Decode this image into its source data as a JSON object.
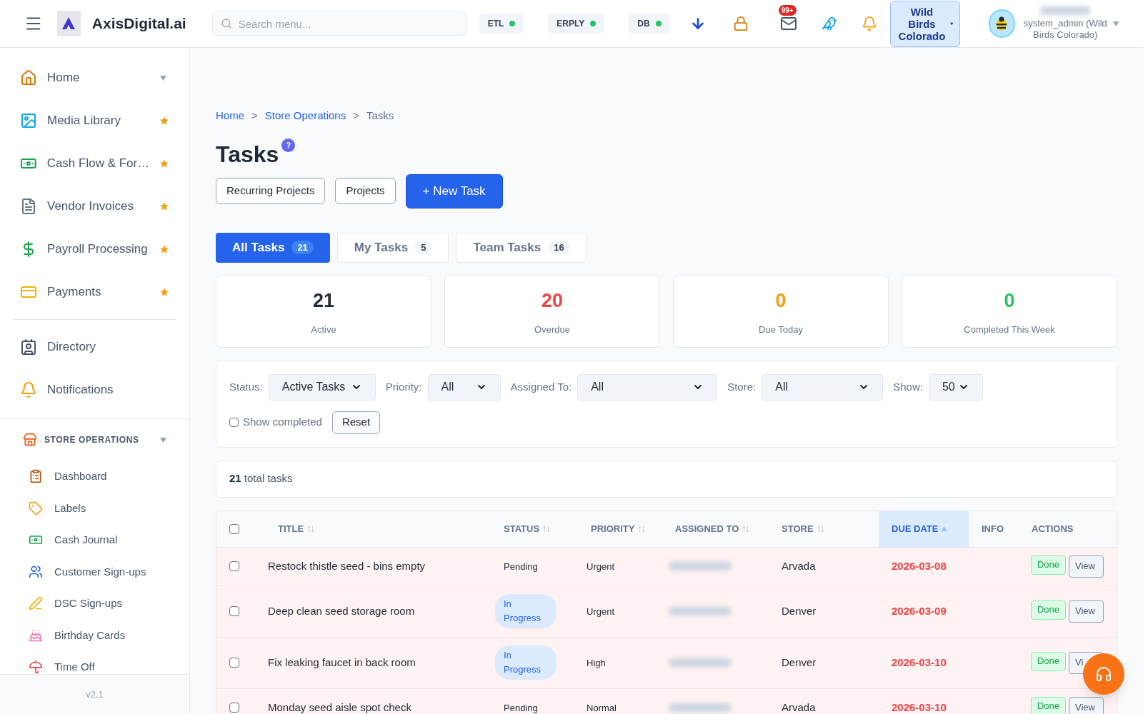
{
  "header": {
    "brand": "AxisDigital.ai",
    "search": {
      "placeholder": "Search menu..."
    },
    "services": [
      {
        "label": "ETL",
        "color": "#22c55e"
      },
      {
        "label": "ERPLY",
        "color": "#22c55e"
      },
      {
        "label": "DB",
        "color": "#22c55e"
      }
    ],
    "mail_badge": "99+",
    "store_button": "Wild Birds Colorado",
    "user_role": "system_admin (Wild Birds Colorado)"
  },
  "sidebar": {
    "items": [
      {
        "label": "Home",
        "expandable": true,
        "starred": false
      },
      {
        "label": "Media Library",
        "expandable": false,
        "starred": true
      },
      {
        "label": "Cash Flow & For…",
        "expandable": false,
        "starred": true
      },
      {
        "label": "Vendor Invoices",
        "expandable": false,
        "starred": true
      },
      {
        "label": "Payroll Processing",
        "expandable": false,
        "starred": true
      },
      {
        "label": "Payments",
        "expandable": false,
        "starred": true
      }
    ],
    "items2": [
      {
        "label": "Directory"
      },
      {
        "label": "Notifications"
      }
    ],
    "section": {
      "title": "STORE OPERATIONS",
      "expanded": true,
      "children": [
        {
          "label": "Dashboard"
        },
        {
          "label": "Labels"
        },
        {
          "label": "Cash Journal"
        },
        {
          "label": "Customer Sign-ups"
        },
        {
          "label": "DSC Sign-ups"
        },
        {
          "label": "Birthday Cards"
        },
        {
          "label": "Time Off"
        }
      ]
    },
    "version": "v2.1"
  },
  "breadcrumb": [
    {
      "label": "Home",
      "kind": "link"
    },
    {
      "label": ">",
      "kind": "separator"
    },
    {
      "label": "Store Operations",
      "kind": "link"
    },
    {
      "label": ">",
      "kind": "separator"
    },
    {
      "label": "Tasks",
      "kind": "current"
    }
  ],
  "title": "Tasks",
  "help": "?",
  "actions": [
    {
      "label": "Recurring Projects",
      "kind": "outline"
    },
    {
      "label": "Projects",
      "kind": "outline"
    },
    {
      "label": "+ New Task",
      "kind": "primary"
    }
  ],
  "tabs": [
    {
      "label": "All Tasks",
      "count": "21",
      "selected": true
    },
    {
      "label": "My Tasks",
      "count": "5",
      "selected": false
    },
    {
      "label": "Team Tasks",
      "count": "16",
      "selected": false
    }
  ],
  "stats": [
    {
      "value": "21",
      "label": "Active",
      "color": "#1f2937"
    },
    {
      "value": "20",
      "label": "Overdue",
      "color": "#ef4444"
    },
    {
      "value": "0",
      "label": "Due Today",
      "color": "#f59e0b"
    },
    {
      "value": "0",
      "label": "Completed This Week",
      "color": "#22c55e"
    }
  ],
  "filters": [
    {
      "label": "Status:",
      "value": "Active Tasks"
    },
    {
      "label": "Priority:",
      "value": "All"
    },
    {
      "label": "Assigned To:",
      "value": "All"
    },
    {
      "label": "Store:",
      "value": "All"
    },
    {
      "label": "Show:",
      "value": "50"
    }
  ],
  "show_completed": {
    "label": "Show completed",
    "checked": false
  },
  "reset": "Reset",
  "total": {
    "count": "21",
    "text": "total tasks"
  },
  "table": {
    "all_checked": false,
    "columns": [
      {
        "label": "TITLE",
        "sortable": true,
        "selected": false
      },
      {
        "label": "STATUS",
        "sortable": true,
        "selected": false
      },
      {
        "label": "PRIORITY",
        "sortable": true,
        "selected": false
      },
      {
        "label": "ASSIGNED TO",
        "sortable": true,
        "selected": false
      },
      {
        "label": "STORE",
        "sortable": true,
        "selected": false
      },
      {
        "label": "DUE DATE",
        "sortable": true,
        "selected": true
      },
      {
        "label": "INFO",
        "selected": false
      },
      {
        "label": "ACTIONS",
        "selected": false
      }
    ],
    "rows": [
      {
        "checked": false,
        "overdue": true,
        "title": "Restock thistle seed - bins empty",
        "status": {
          "label": "Pending",
          "kind": "pending"
        },
        "priority": "Urgent",
        "store": "Arvada",
        "due": "2026-03-08",
        "done": "Done",
        "view": "View"
      },
      {
        "checked": false,
        "overdue": true,
        "title": "Deep clean seed storage room",
        "status": {
          "label": "In Progress",
          "kind": "progress"
        },
        "priority": "Urgent",
        "store": "Denver",
        "due": "2026-03-09",
        "done": "Done",
        "view": "View"
      },
      {
        "checked": false,
        "overdue": true,
        "title": "Fix leaking faucet in back room",
        "status": {
          "label": "In Progress",
          "kind": "progress"
        },
        "priority": "High",
        "store": "Denver",
        "due": "2026-03-10",
        "done": "Done",
        "view": "Vi"
      },
      {
        "checked": false,
        "overdue": true,
        "title": "Monday seed aisle spot check",
        "status": {
          "label": "Pending",
          "kind": "pending"
        },
        "priority": "Normal",
        "store": "Arvada",
        "due": "2026-03-10",
        "done": "Done",
        "view": "View"
      }
    ]
  }
}
